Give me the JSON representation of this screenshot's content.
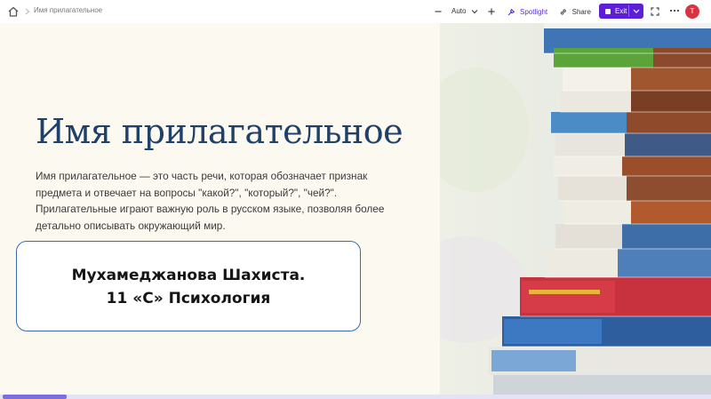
{
  "toolbar": {
    "breadcrumb": "Имя прилагательное",
    "zoom_value": "Auto",
    "spotlight_label": "Spotlight",
    "share_label": "Share",
    "exit_label": "Exit",
    "avatar_initial": "T",
    "icons": [
      "home-icon",
      "chevron-right-icon",
      "minus-icon",
      "chevron-down-icon",
      "plus-icon",
      "spotlight-icon",
      "link-icon",
      "stop-icon",
      "fullscreen-icon",
      "more-icon"
    ]
  },
  "slide": {
    "title": "Имя прилагательное",
    "body": "Имя прилагательное — это часть речи, которая обозначает признак предмета и отвечает на вопросы \"какой?\", \"который?\", \"чей?\". Прилагательные играют важную роль в русском языке, позволяя более детально описывать окружающий мир.",
    "author_line1": "Мухамеджанова Шахиста.",
    "author_line2": "11 «С» Психология"
  },
  "progress": {
    "fraction": 0.09
  },
  "colors": {
    "accent": "#5b1fd6",
    "title": "#1f4069",
    "avatar": "#d9333f",
    "progress": "#7a6ee0"
  }
}
